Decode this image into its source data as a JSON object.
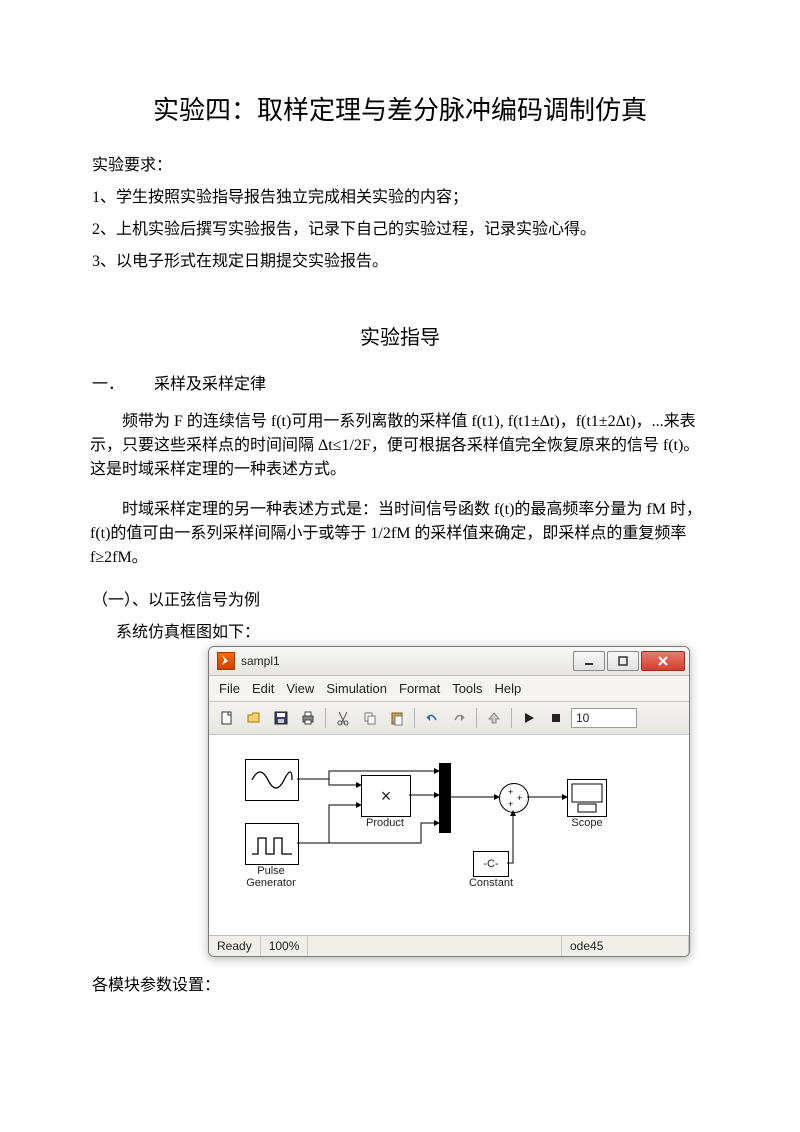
{
  "title": "实验四：取样定理与差分脉冲编码调制仿真",
  "req_label": "实验要求：",
  "req_items": [
    "1、学生按照实验指导报告独立完成相关实验的内容；",
    "2、上机实验后撰写实验报告，记录下自己的实验过程，记录实验心得。",
    "3、以电子形式在规定日期提交实验报告。"
  ],
  "guide_title": "实验指导",
  "section1": {
    "num": "一．",
    "title": "采样及采样定律"
  },
  "para1": "频带为 F 的连续信号 f(t)可用一系列离散的采样值 f(t1), f(t1±Δt)，f(t1±2Δt)，...来表示，只要这些采样点的时间间隔 Δt≤1/2F，便可根据各采样值完全恢复原来的信号 f(t)。 这是时域采样定理的一种表述方式。",
  "para2": "时域采样定理的另一种表述方式是：当时间信号函数 f(t)的最高频率分量为 fM 时，f(t)的值可由一系列采样间隔小于或等于 1/2fM 的采样值来确定，即采样点的重复频率 f≥2fM。",
  "subsection": "（一）、以正弦信号为例",
  "caption": "系统仿真框图如下：",
  "window": {
    "title": "sampl1",
    "menus": [
      "File",
      "Edit",
      "View",
      "Simulation",
      "Format",
      "Tools",
      "Help"
    ],
    "sim_time": "10",
    "blocks": {
      "product": "Product",
      "pulse": "Pulse\nGenerator",
      "constant": "Constant",
      "constant_val": "-C-",
      "scope": "Scope",
      "product_sym": "×"
    },
    "status": {
      "ready": "Ready",
      "zoom": "100%",
      "solver": "ode45"
    }
  },
  "footer_note": "各模块参数设置："
}
